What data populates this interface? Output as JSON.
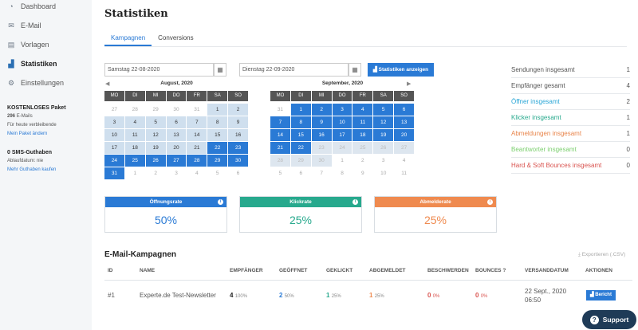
{
  "sidebar": {
    "items": [
      {
        "label": "Dashboard",
        "icon": "dashboard-icon"
      },
      {
        "label": "E-Mail",
        "icon": "envelope-icon"
      },
      {
        "label": "Vorlagen",
        "icon": "file-icon"
      },
      {
        "label": "Statistiken",
        "icon": "chart-icon",
        "active": true
      },
      {
        "label": "Einstellungen",
        "icon": "gear-icon"
      }
    ],
    "package": {
      "title": "KOSTENLOSES Paket",
      "emails_count": "296",
      "emails_label": "E-Mails",
      "remaining": "Für heute verbleibende",
      "link": "Mein Paket ändern"
    },
    "sms": {
      "title": "0 SMS-Guthaben",
      "expiry": "Ablaufdatum: nie",
      "link": "Mehr Guthaben kaufen"
    }
  },
  "page": {
    "title": "Statistiken",
    "tabs": [
      "Kampagnen",
      "Conversions"
    ],
    "active_tab": "Kampagnen"
  },
  "filters": {
    "start_date": "Samstag 22-08-2020",
    "end_date": "Dienstag 22-09-2020",
    "submit_label": "Statistiken anzeigen"
  },
  "calendars": {
    "weekdays": [
      "MO",
      "DI",
      "MI",
      "DO",
      "FR",
      "SA",
      "SO"
    ],
    "left_title": "August, 2020",
    "right_title": "September, 2020",
    "left_weeks": [
      [
        [
          "27",
          "out"
        ],
        [
          "28",
          "out"
        ],
        [
          "29",
          "out"
        ],
        [
          "30",
          "out"
        ],
        [
          "31",
          "out"
        ],
        [
          "1",
          "range"
        ],
        [
          "2",
          "range"
        ]
      ],
      [
        [
          "3",
          "range"
        ],
        [
          "4",
          "range"
        ],
        [
          "5",
          "range"
        ],
        [
          "6",
          "range"
        ],
        [
          "7",
          "range"
        ],
        [
          "8",
          "range"
        ],
        [
          "9",
          "range"
        ]
      ],
      [
        [
          "10",
          "range"
        ],
        [
          "11",
          "range"
        ],
        [
          "12",
          "range"
        ],
        [
          "13",
          "range"
        ],
        [
          "14",
          "range"
        ],
        [
          "15",
          "range"
        ],
        [
          "16",
          "range"
        ]
      ],
      [
        [
          "17",
          "range"
        ],
        [
          "18",
          "range"
        ],
        [
          "19",
          "range"
        ],
        [
          "20",
          "range"
        ],
        [
          "21",
          "range"
        ],
        [
          "22",
          "sel"
        ],
        [
          "23",
          "sel"
        ]
      ],
      [
        [
          "24",
          "sel"
        ],
        [
          "25",
          "sel"
        ],
        [
          "26",
          "sel"
        ],
        [
          "27",
          "sel"
        ],
        [
          "28",
          "sel"
        ],
        [
          "29",
          "sel"
        ],
        [
          "30",
          "sel"
        ]
      ],
      [
        [
          "31",
          "sel"
        ],
        [
          "1",
          "out"
        ],
        [
          "2",
          "out"
        ],
        [
          "3",
          "out"
        ],
        [
          "4",
          "out"
        ],
        [
          "5",
          "out"
        ],
        [
          "6",
          "out"
        ]
      ]
    ],
    "right_weeks": [
      [
        [
          "31",
          "out"
        ],
        [
          "1",
          "sel"
        ],
        [
          "2",
          "sel"
        ],
        [
          "3",
          "sel"
        ],
        [
          "4",
          "sel"
        ],
        [
          "5",
          "sel"
        ],
        [
          "6",
          "sel"
        ]
      ],
      [
        [
          "7",
          "sel"
        ],
        [
          "8",
          "sel"
        ],
        [
          "9",
          "sel"
        ],
        [
          "10",
          "sel"
        ],
        [
          "11",
          "sel"
        ],
        [
          "12",
          "sel"
        ],
        [
          "13",
          "sel"
        ]
      ],
      [
        [
          "14",
          "sel"
        ],
        [
          "15",
          "sel"
        ],
        [
          "16",
          "sel"
        ],
        [
          "17",
          "sel"
        ],
        [
          "18",
          "sel"
        ],
        [
          "19",
          "sel"
        ],
        [
          "20",
          "sel"
        ]
      ],
      [
        [
          "21",
          "sel"
        ],
        [
          "22",
          "sel"
        ],
        [
          "23",
          "outrange"
        ],
        [
          "24",
          "outrange"
        ],
        [
          "25",
          "outrange"
        ],
        [
          "26",
          "outrange"
        ],
        [
          "27",
          "outrange"
        ]
      ],
      [
        [
          "28",
          "outrange"
        ],
        [
          "29",
          "outrange"
        ],
        [
          "30",
          "outrange"
        ],
        [
          "1",
          "out"
        ],
        [
          "2",
          "out"
        ],
        [
          "3",
          "out"
        ],
        [
          "4",
          "out"
        ]
      ],
      [
        [
          "5",
          "out"
        ],
        [
          "6",
          "out"
        ],
        [
          "7",
          "out"
        ],
        [
          "8",
          "out"
        ],
        [
          "9",
          "out"
        ],
        [
          "10",
          "out"
        ],
        [
          "11",
          "out"
        ]
      ]
    ]
  },
  "summary": [
    {
      "label": "Sendungen insgesamt",
      "value": "1",
      "color": "#555555"
    },
    {
      "label": "Empfänger gesamt",
      "value": "4",
      "color": "#555555"
    },
    {
      "label": "Öffner insgesamt",
      "value": "2",
      "color": "#2aa6d6"
    },
    {
      "label": "Klicker insgesamt",
      "value": "1",
      "color": "#27a98d"
    },
    {
      "label": "Abmeldungen insgesamt",
      "value": "1",
      "color": "#e8844a"
    },
    {
      "label": "Beantworter insgesamt",
      "value": "0",
      "color": "#7ccf6f"
    },
    {
      "label": "Hard & Soft Bounces insgesamt",
      "value": "0",
      "color": "#d9534f"
    }
  ],
  "rates": [
    {
      "title": "Öffnungsrate",
      "value": "50%",
      "color": "#2a7ad5"
    },
    {
      "title": "Klickrate",
      "value": "25%",
      "color": "#27a98d"
    },
    {
      "title": "Abmelderate",
      "value": "25%",
      "color": "#ef8a4f"
    }
  ],
  "campaigns": {
    "title": "E-Mail-Kampagnen",
    "export_label": "Exportieren (.CSV)",
    "headers": [
      "ID",
      "NAME",
      "EMPFÄNGER",
      "GEÖFFNET",
      "GEKLICKT",
      "ABGEMELDET",
      "BESCHWERDEN",
      "BOUNCES",
      "VERSANDDATUM",
      "AKTIONEN"
    ],
    "row": {
      "id": "#1",
      "name": "Experte.de Test-Newsletter",
      "recipients": "4",
      "recipients_pct": "100%",
      "opened": "2",
      "opened_pct": "50%",
      "clicked": "1",
      "clicked_pct": "25%",
      "unsub": "1",
      "unsub_pct": "25%",
      "complaints": "0",
      "complaints_pct": "0%",
      "bounces": "0",
      "bounces_pct": "0%",
      "date_line1": "22 Sept., 2020",
      "date_line2": "06:50",
      "action": "Bericht"
    }
  },
  "support_label": "Support"
}
